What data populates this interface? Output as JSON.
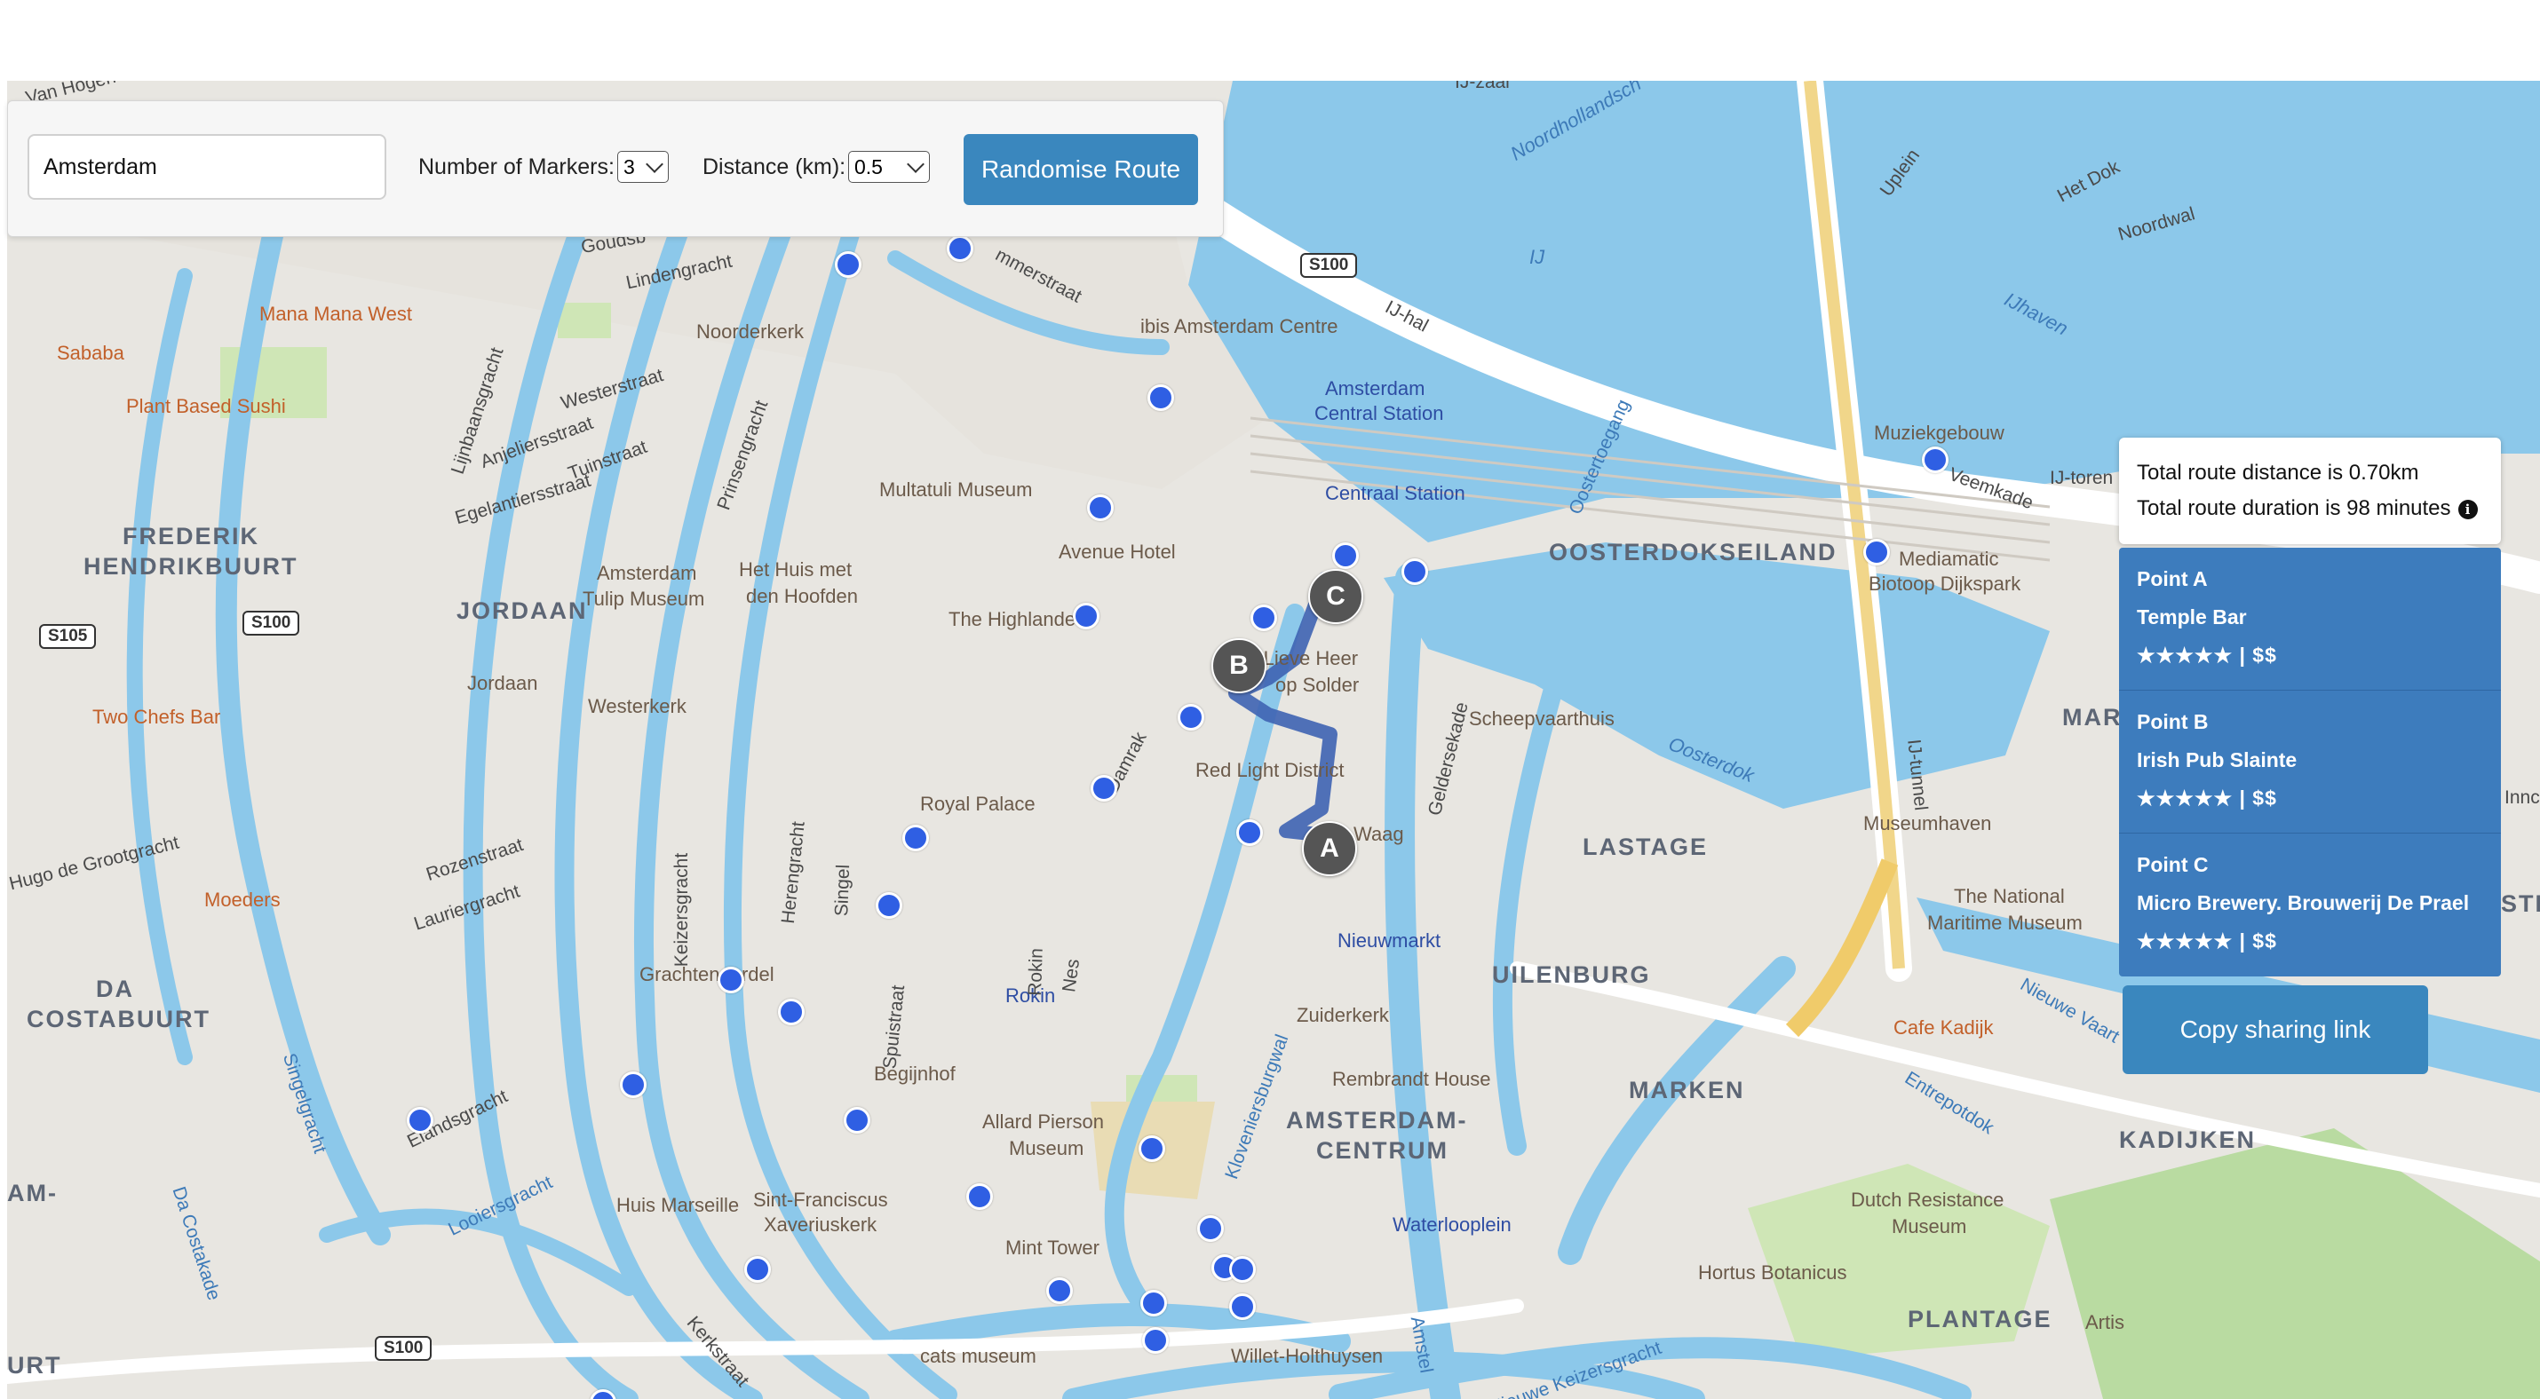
{
  "controls": {
    "city_value": "Amsterdam",
    "markers_label": "Number of Markers:",
    "markers_value": "3",
    "distance_label": "Distance (km):",
    "distance_value": "0.5",
    "randomise_label": "Randomise Route"
  },
  "route_info": {
    "distance_text": "Total route distance is 0.70km",
    "duration_text": "Total route duration is 98 minutes",
    "info_icon": "info-icon"
  },
  "points": [
    {
      "title": "Point A",
      "name": "Temple Bar",
      "rating": "★★★★★ | $$"
    },
    {
      "title": "Point B",
      "name": "Irish Pub Slainte",
      "rating": "★★★★★ | $$"
    },
    {
      "title": "Point C",
      "name": "Micro Brewery. Brouwerij De Prael",
      "rating": "★★★★★ | $$"
    }
  ],
  "share_label": "Copy sharing link",
  "route_badges": [
    "A",
    "B",
    "C"
  ],
  "map": {
    "districts": [
      "FREDERIK",
      "HENDRIKBUURT",
      "JORDAAN",
      "DA",
      "COSTABUURT",
      "OOSTERDOKSEILAND",
      "MARINE",
      "LASTAGE",
      "UILENBURG",
      "MARKEN",
      "AMSTERDAM-",
      "CENTRUM",
      "KADIJKEN",
      "PLANTAGE"
    ],
    "pois": [
      "Mana Mana West",
      "Sababa",
      "Plant Based Sushi",
      "Two Chefs Bar",
      "Moeders",
      "Cafe Kadijk",
      "Noorderkerk",
      "Westerkerk",
      "Amsterdam",
      "Tulip Museum",
      "Het Huis met",
      "den Hoofden",
      "Multatuli Museum",
      "Avenue Hotel",
      "The Highlander",
      "ibis Amsterdam Centre",
      "Ons' Lieve Heer",
      "op Solder",
      "Red Light District",
      "Waag",
      "Royal Palace",
      "Scheepvaarthuis",
      "Zuiderkerk",
      "Rembrandt House",
      "Allard Pierson",
      "Museum",
      "Begijnhof",
      "Huis Marseille",
      "Sint-Franciscus",
      "Xaveriuskerk",
      "Mint Tower",
      "cats museum",
      "Willet-Holthuysen",
      "Hortus Botanicus",
      "Artis",
      "Dutch Resistance",
      "Museum",
      "The National",
      "Maritime Museum",
      "Museumhaven",
      "Muziekgebouw",
      "Mediamatic",
      "Biotoop Dijkspark",
      "Grachtengordel",
      "Jordaan"
    ],
    "transit": [
      "Amsterdam",
      "Central Station",
      "Centraal Station",
      "Rokin",
      "Nieuwmarkt",
      "Waterlooplein"
    ],
    "streets": [
      "Lindengracht",
      "Goudsb",
      "mmerstraat",
      "Westerstraat",
      "Anjeliersstraat",
      "Tuinstraat",
      "Egelantiersstraat",
      "Lijnbaansgracht",
      "Prinsengracht",
      "Keizersgracht",
      "Herengracht",
      "Singel",
      "Spuistraat",
      "Rokin",
      "Nes",
      "Damrak",
      "Geldersekade",
      "Kloveniersburgwal",
      "Rozenstraat",
      "Lauriergracht",
      "Elandsgracht",
      "Looiersgracht",
      "Da Costakade",
      "Singelgracht",
      "IJ-hal",
      "Veemkade",
      "IJ-tunnel",
      "Uplein",
      "Noordwal",
      "Het Dok",
      "Oostertoegang",
      "Entrepotdok",
      "Nieuwe Vaart",
      "Nieuwe Keizersgracht",
      "Amstel",
      "Kerkstraat",
      "IJ-toren",
      "Hugo de Grootgracht",
      "Van Hogen",
      "IJ-zaal",
      "AM-",
      "URT",
      "Innc",
      "STI"
    ],
    "water": [
      "Oosterdok",
      "IJ",
      "IJhaven",
      "Noordhollandsch"
    ],
    "roads": [
      "S100",
      "S100",
      "S105",
      "S100"
    ]
  }
}
